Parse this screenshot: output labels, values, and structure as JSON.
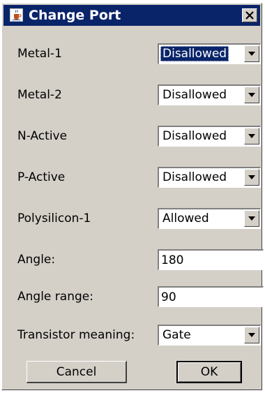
{
  "window": {
    "title": "Change Port",
    "app_icon": "java-cup-icon",
    "close_icon": "close-icon"
  },
  "rows": [
    {
      "label": "Metal-1",
      "type": "combo",
      "value": "Disallowed",
      "focused": true
    },
    {
      "label": "Metal-2",
      "type": "combo",
      "value": "Disallowed"
    },
    {
      "label": "N-Active",
      "type": "combo",
      "value": "Disallowed"
    },
    {
      "label": "P-Active",
      "type": "combo",
      "value": "Disallowed"
    },
    {
      "label": "Polysilicon-1",
      "type": "combo",
      "value": "Allowed"
    },
    {
      "label": "Angle:",
      "type": "text",
      "value": "180"
    },
    {
      "label": "Angle range:",
      "type": "text",
      "value": "90"
    },
    {
      "label": "Transistor meaning:",
      "type": "combo",
      "value": "Gate"
    }
  ],
  "buttons": {
    "cancel": "Cancel",
    "ok": "OK"
  },
  "colors": {
    "titlebar": "#0a246a",
    "dialog_bg": "#d4d0c8",
    "selection": "#0a246a"
  }
}
